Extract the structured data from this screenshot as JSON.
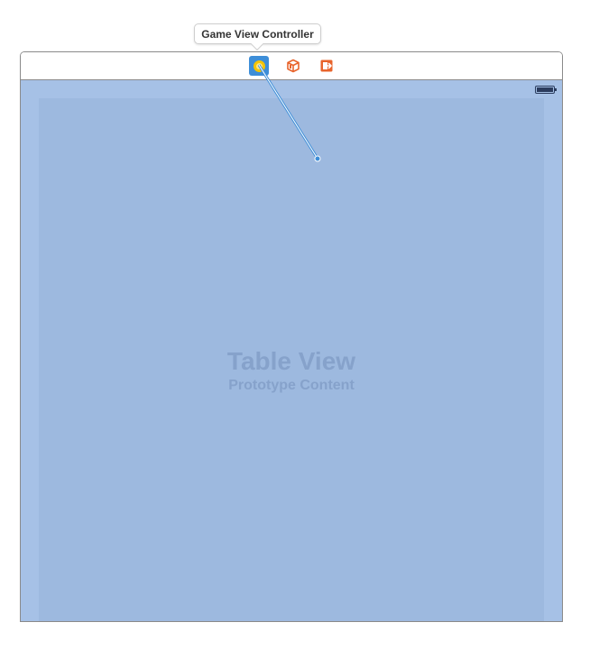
{
  "tooltip": {
    "label": "Game View Controller"
  },
  "scene_dock": {
    "icons": [
      {
        "name": "view-controller-icon",
        "selected": true
      },
      {
        "name": "first-responder-icon",
        "selected": false
      },
      {
        "name": "exit-icon",
        "selected": false
      }
    ]
  },
  "table_view": {
    "title": "Table View",
    "subtitle": "Prototype Content"
  },
  "colors": {
    "selection": "#3d8ed8",
    "view_background": "#a6c1e6",
    "table_background": "#9db9df",
    "placeholder_text": "#86a2cb",
    "dock_icon_orange": "#e8642c",
    "vc_icon_yellow": "#f5c400"
  }
}
